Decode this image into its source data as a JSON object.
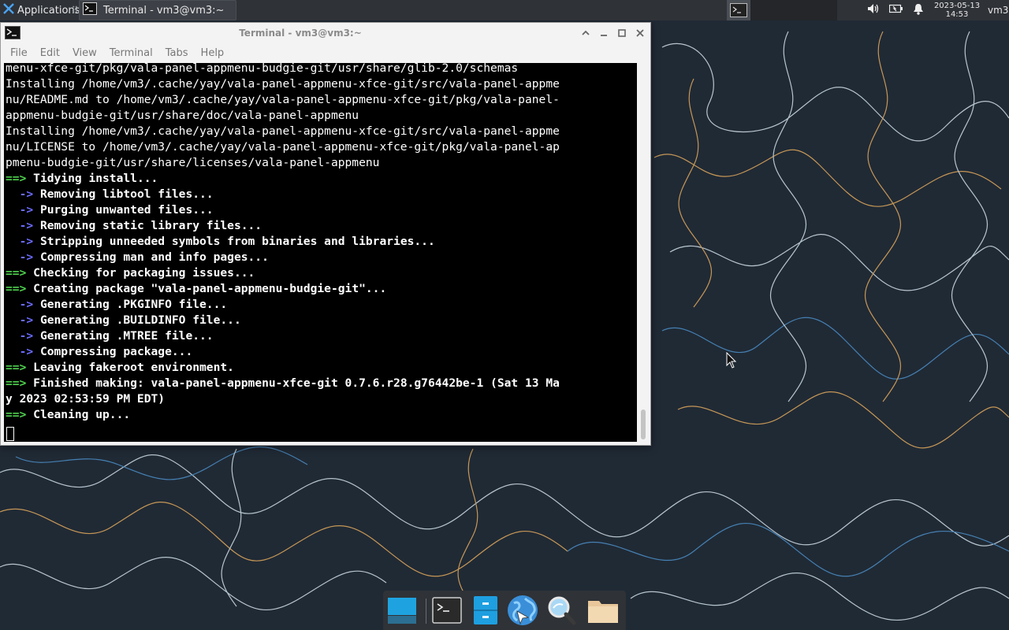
{
  "top_panel": {
    "applications_label": "Applications",
    "separator": "⠿",
    "task_button_label": "Terminal - vm3@vm3:~",
    "clock_date": "2023-05-13",
    "clock_time": "14:53",
    "user": "vm3",
    "tray_icons": [
      "volume-icon",
      "battery-icon",
      "notification-bell-icon"
    ]
  },
  "terminal_window": {
    "title": "Terminal - vm3@vm3:~",
    "menu": [
      "File",
      "Edit",
      "View",
      "Terminal",
      "Tabs",
      "Help"
    ],
    "lines": [
      {
        "type": "plain",
        "text": "menu-xfce-git/pkg/vala-panel-appmenu-budgie-git/usr/share/glib-2.0/schemas"
      },
      {
        "type": "plain",
        "text": "Installing /home/vm3/.cache/yay/vala-panel-appmenu-xfce-git/src/vala-panel-appme"
      },
      {
        "type": "plain",
        "text": "nu/README.md to /home/vm3/.cache/yay/vala-panel-appmenu-xfce-git/pkg/vala-panel-"
      },
      {
        "type": "plain",
        "text": "appmenu-budgie-git/usr/share/doc/vala-panel-appmenu"
      },
      {
        "type": "plain",
        "text": "Installing /home/vm3/.cache/yay/vala-panel-appmenu-xfce-git/src/vala-panel-appme"
      },
      {
        "type": "plain",
        "text": "nu/LICENSE to /home/vm3/.cache/yay/vala-panel-appmenu-xfce-git/pkg/vala-panel-ap"
      },
      {
        "type": "plain",
        "text": "pmenu-budgie-git/usr/share/licenses/vala-panel-appmenu"
      },
      {
        "type": "green",
        "text": "Tidying install..."
      },
      {
        "type": "blue",
        "text": "Removing libtool files..."
      },
      {
        "type": "blue",
        "text": "Purging unwanted files..."
      },
      {
        "type": "blue",
        "text": "Removing static library files..."
      },
      {
        "type": "blue",
        "text": "Stripping unneeded symbols from binaries and libraries..."
      },
      {
        "type": "blue",
        "text": "Compressing man and info pages..."
      },
      {
        "type": "green",
        "text": "Checking for packaging issues..."
      },
      {
        "type": "green",
        "text": "Creating package \"vala-panel-appmenu-budgie-git\"..."
      },
      {
        "type": "blue",
        "text": "Generating .PKGINFO file..."
      },
      {
        "type": "blue",
        "text": "Generating .BUILDINFO file..."
      },
      {
        "type": "blue",
        "text": "Generating .MTREE file..."
      },
      {
        "type": "blue",
        "text": "Compressing package..."
      },
      {
        "type": "green",
        "text": "Leaving fakeroot environment."
      },
      {
        "type": "green",
        "text": "Finished making: vala-panel-appmenu-xfce-git 0.7.6.r28.g76442be-1 (Sat 13 Ma"
      },
      {
        "type": "bold",
        "text": "y 2023 02:53:59 PM EDT)"
      },
      {
        "type": "green",
        "text": "Cleaning up..."
      }
    ],
    "green_prefix": "==> ",
    "blue_prefix": "  -> "
  },
  "dock": {
    "items": [
      "show-desktop-icon",
      "terminal-icon",
      "file-manager-icon",
      "web-browser-icon",
      "app-finder-icon",
      "folder-icon"
    ]
  },
  "colors": {
    "panel_bg": "#2f3237",
    "terminal_bg": "#000000",
    "arrow_green": "#4ed24e",
    "arrow_blue": "#6b6bff",
    "wallpaper_bg": "#202a35"
  }
}
